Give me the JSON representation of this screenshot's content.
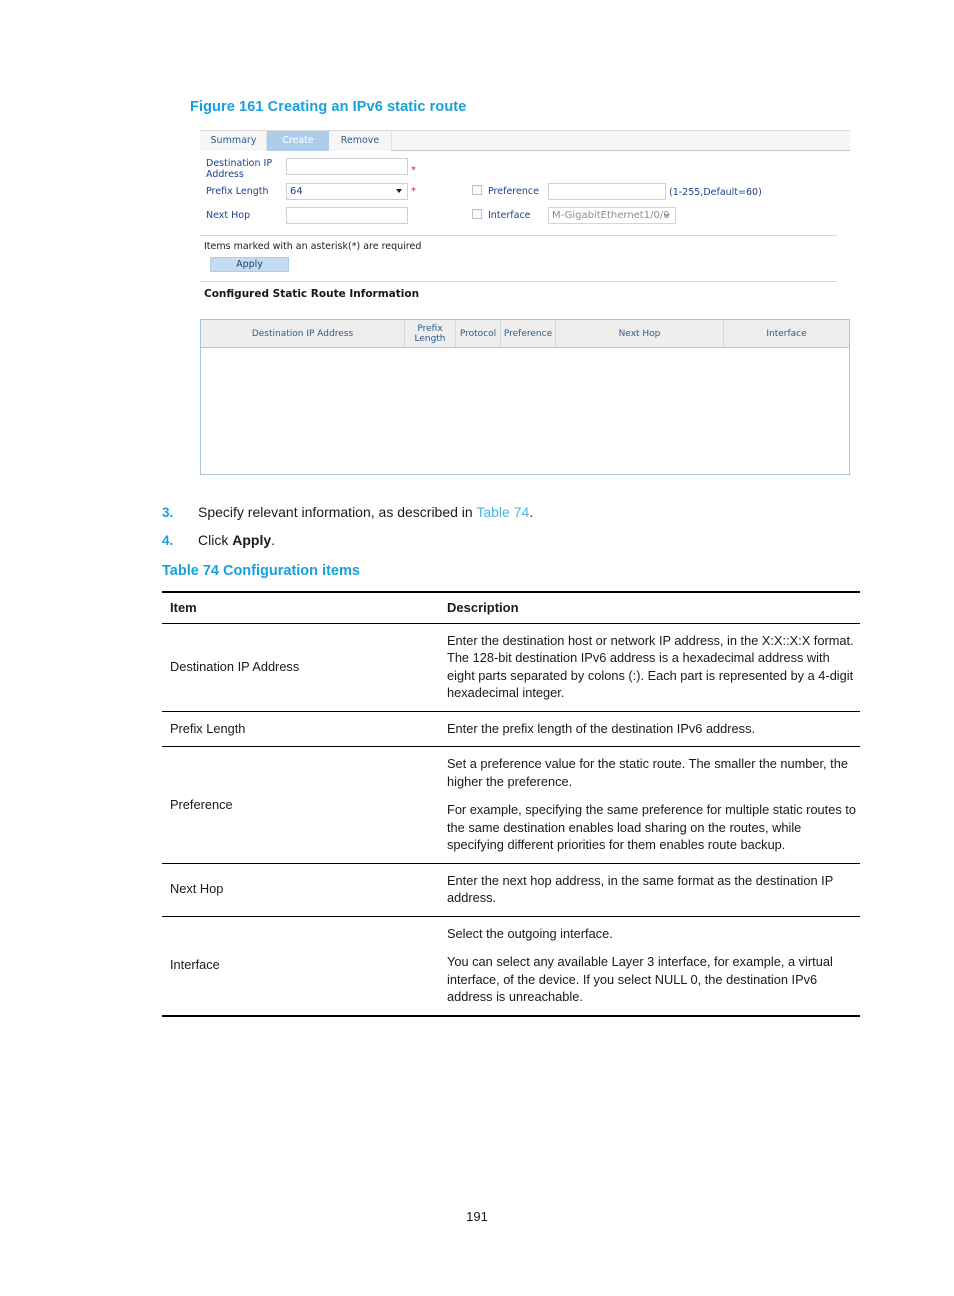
{
  "document": {
    "figure_caption": "Figure 161 Creating an IPv6 static route",
    "table_caption": "Table 74 Configuration items",
    "page_number": "191",
    "steps": [
      {
        "number": "3.",
        "text_before": "Specify relevant information, as described in ",
        "link": "Table 74",
        "text_after": "."
      },
      {
        "number": "4.",
        "text_before": "Click ",
        "bold": "Apply",
        "text_after": "."
      }
    ]
  },
  "screenshot": {
    "tabs": [
      {
        "label": "Summary",
        "active": false
      },
      {
        "label": "Create",
        "active": true
      },
      {
        "label": "Remove",
        "active": false
      }
    ],
    "form": {
      "destination_ip_label": "Destination IP\nAddress",
      "destination_ip_label_line1": "Destination IP",
      "destination_ip_label_line2": "Address",
      "destination_ip_value": "",
      "destination_ip_required_mark": "*",
      "prefix_length_label": "Prefix Length",
      "prefix_length_value": "64",
      "prefix_length_required_mark": "*",
      "next_hop_label": "Next Hop",
      "next_hop_value": "",
      "preference_checkbox_label": "Preference",
      "preference_value": "",
      "preference_hint": "(1-255,Default=60)",
      "interface_checkbox_label": "Interface",
      "interface_value": "M-GigabitEthernet1/0/0"
    },
    "note": "Items marked with an asterisk(*) are required",
    "apply_label": "Apply",
    "section_title": "Configured Static Route Information",
    "grid": {
      "columns": [
        "Destination IP Address",
        "Prefix\nLength",
        "Protocol",
        "Preference",
        "Next Hop",
        "Interface"
      ],
      "col_prefix_length_line1": "Prefix",
      "col_prefix_length_line2": "Length",
      "col_destination": "Destination IP Address",
      "col_protocol": "Protocol",
      "col_preference": "Preference",
      "col_next_hop": "Next Hop",
      "col_interface": "Interface",
      "rows": []
    }
  },
  "config_table": {
    "headers": {
      "item": "Item",
      "description": "Description"
    },
    "rows": [
      {
        "item": "Destination IP Address",
        "description": [
          "Enter the destination host or network IP address, in the X:X::X:X format. The 128-bit destination IPv6 address is a hexadecimal address with eight parts separated by colons (:). Each part is represented by a 4-digit hexadecimal integer."
        ]
      },
      {
        "item": "Prefix Length",
        "description": [
          "Enter the prefix length of the destination IPv6 address."
        ]
      },
      {
        "item": "Preference",
        "description": [
          "Set a preference value for the static route. The smaller the number, the higher the preference.",
          "For example, specifying the same preference for multiple static routes to the same destination enables load sharing on the routes, while specifying different priorities for them enables route backup."
        ]
      },
      {
        "item": "Next Hop",
        "description": [
          "Enter the next hop address, in the same format as the destination IP address."
        ]
      },
      {
        "item": "Interface",
        "description": [
          "Select the outgoing interface.",
          "You can select any available Layer 3 interface, for example, a virtual interface, of the device. If you select NULL 0, the destination IPv6 address is unreachable."
        ]
      }
    ]
  },
  "colors": {
    "accent_heading": "#17a0dc",
    "xref_link": "#4fb4e0",
    "active_tab_bg": "#aecdeb",
    "apply_button_bg": "#c6dcf2",
    "required_star": "#e0222a",
    "grid_border": "#a9c6e0",
    "app_text": "#20418f"
  }
}
